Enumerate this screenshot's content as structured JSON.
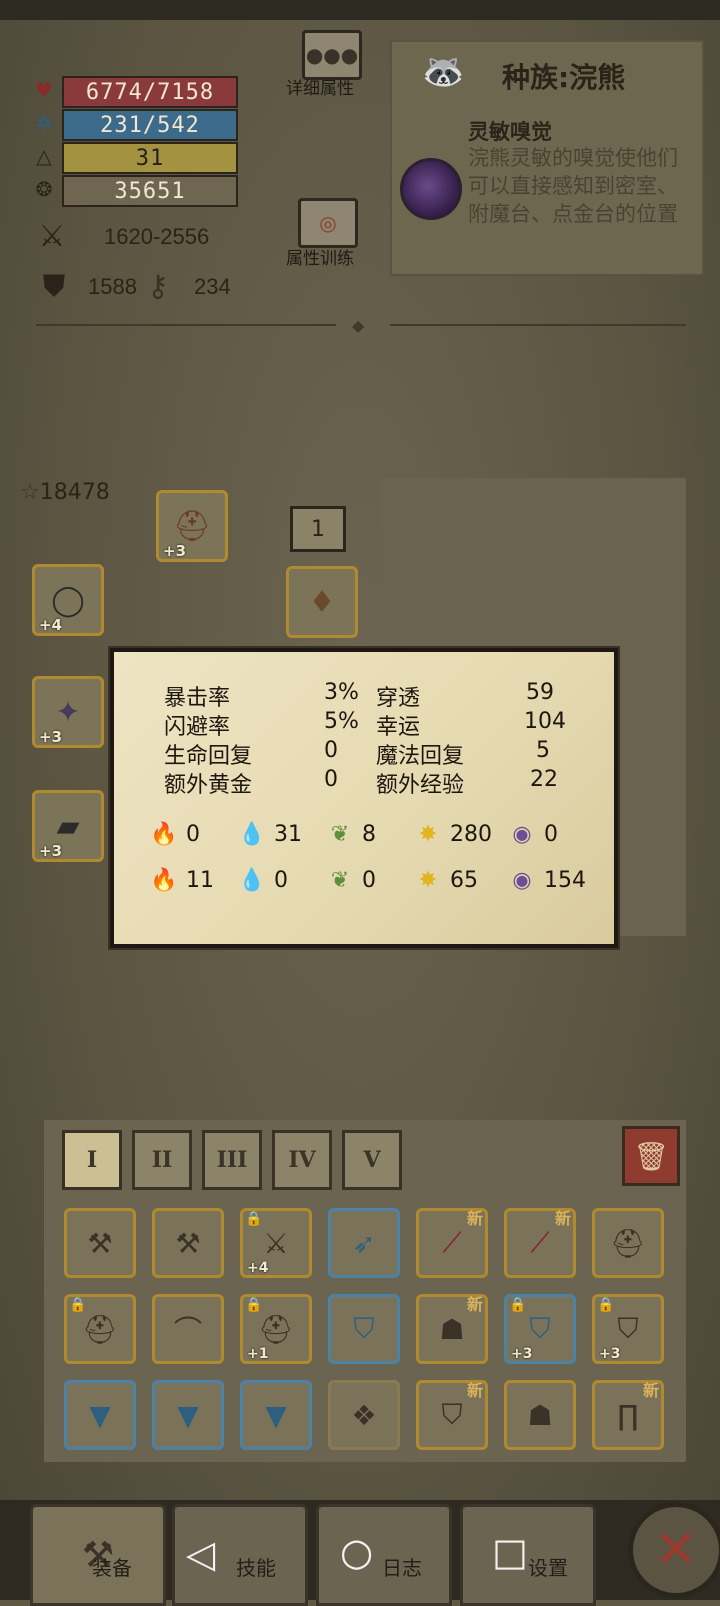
{
  "stats": {
    "hp": "6774/7158",
    "mp": "231/542",
    "level": "31",
    "gold": "35651",
    "attack": "1620-2556",
    "defense": "1588",
    "keys": "234"
  },
  "buttons": {
    "details": "详细属性",
    "training": "属性训练"
  },
  "race": {
    "title": "种族:浣熊",
    "skill_name": "灵敏嗅觉",
    "skill_desc": "浣熊灵敏的嗅觉使他们可以直接感知到密室、附魔台、点金台的位置"
  },
  "equipment": {
    "score": "18478",
    "level_box": "1",
    "slots": [
      {
        "name": "helmet-slot",
        "plus": "+3"
      },
      {
        "name": "ring-slot",
        "plus": "+4"
      },
      {
        "name": "weapon-slot",
        "plus": "+3"
      },
      {
        "name": "gauntlet-slot",
        "plus": "+3"
      },
      {
        "name": "amulet-slot",
        "plus": ""
      }
    ]
  },
  "popup": {
    "rows": [
      {
        "l1": "暴击率",
        "v1": "3%",
        "l2": "穿透",
        "v2": "59"
      },
      {
        "l1": "闪避率",
        "v1": "5%",
        "l2": "幸运",
        "v2": "104"
      },
      {
        "l1": "生命回复",
        "v1": "0",
        "l2": "魔法回复",
        "v2": "5"
      },
      {
        "l1": "额外黄金",
        "v1": "0",
        "l2": "额外经验",
        "v2": "22"
      }
    ],
    "attack_elements": [
      "0",
      "31",
      "8",
      "280",
      "0"
    ],
    "defense_elements": [
      "11",
      "0",
      "0",
      "65",
      "154"
    ],
    "element_colors": [
      "#c0392b",
      "#3d84b8",
      "#5e8f3a",
      "#e0b51e",
      "#6b4e9a"
    ]
  },
  "inventory": {
    "tabs": [
      "I",
      "II",
      "III",
      "IV",
      "V"
    ],
    "active_tab": 0,
    "new_label": "新",
    "items": [
      {
        "icon": "hammer-icon",
        "border": "gold",
        "plus": "",
        "new": false,
        "lock": false
      },
      {
        "icon": "hammer-icon",
        "border": "gold",
        "plus": "",
        "new": false,
        "lock": false
      },
      {
        "icon": "axe-icon",
        "border": "gold",
        "plus": "+4",
        "new": false,
        "lock": true
      },
      {
        "icon": "thorn-bow-icon",
        "border": "blue",
        "plus": "",
        "new": false,
        "lock": false
      },
      {
        "icon": "crimson-staff-icon",
        "border": "gold",
        "plus": "",
        "new": true,
        "lock": false
      },
      {
        "icon": "crimson-staff-icon",
        "border": "gold",
        "plus": "",
        "new": true,
        "lock": false
      },
      {
        "icon": "knight-helm-icon",
        "border": "gold",
        "plus": "",
        "new": false,
        "lock": false
      },
      {
        "icon": "knight-helm-icon",
        "border": "gold",
        "plus": "",
        "new": false,
        "lock": true
      },
      {
        "icon": "straw-hat-icon",
        "border": "gold",
        "plus": "",
        "new": false,
        "lock": false
      },
      {
        "icon": "chest-helm-icon",
        "border": "gold",
        "plus": "+1",
        "new": false,
        "lock": true
      },
      {
        "icon": "blue-armor-icon",
        "border": "blue",
        "plus": "",
        "new": false,
        "lock": false
      },
      {
        "icon": "hood-icon",
        "border": "gold",
        "plus": "",
        "new": true,
        "lock": false
      },
      {
        "icon": "blue-armor-icon",
        "border": "blue",
        "plus": "+3",
        "new": false,
        "lock": true
      },
      {
        "icon": "leather-armor-icon",
        "border": "gold",
        "plus": "+3",
        "new": false,
        "lock": true
      },
      {
        "icon": "blue-cape-icon",
        "border": "blue",
        "plus": "",
        "new": false,
        "lock": false
      },
      {
        "icon": "blue-cape-icon",
        "border": "blue",
        "plus": "",
        "new": false,
        "lock": false
      },
      {
        "icon": "blue-cape-icon",
        "border": "blue",
        "plus": "",
        "new": false,
        "lock": false
      },
      {
        "icon": "beads-necklace-icon",
        "border": "none",
        "plus": "",
        "new": false,
        "lock": false
      },
      {
        "icon": "leather-vest-icon",
        "border": "gold",
        "plus": "",
        "new": true,
        "lock": false
      },
      {
        "icon": "dark-robe-icon",
        "border": "gold",
        "plus": "",
        "new": false,
        "lock": false
      },
      {
        "icon": "pants-icon",
        "border": "gold",
        "plus": "",
        "new": true,
        "lock": false
      }
    ]
  },
  "bottom_nav": {
    "equip": "装备",
    "skills": "技能",
    "log": "日志",
    "settings": "设置"
  }
}
